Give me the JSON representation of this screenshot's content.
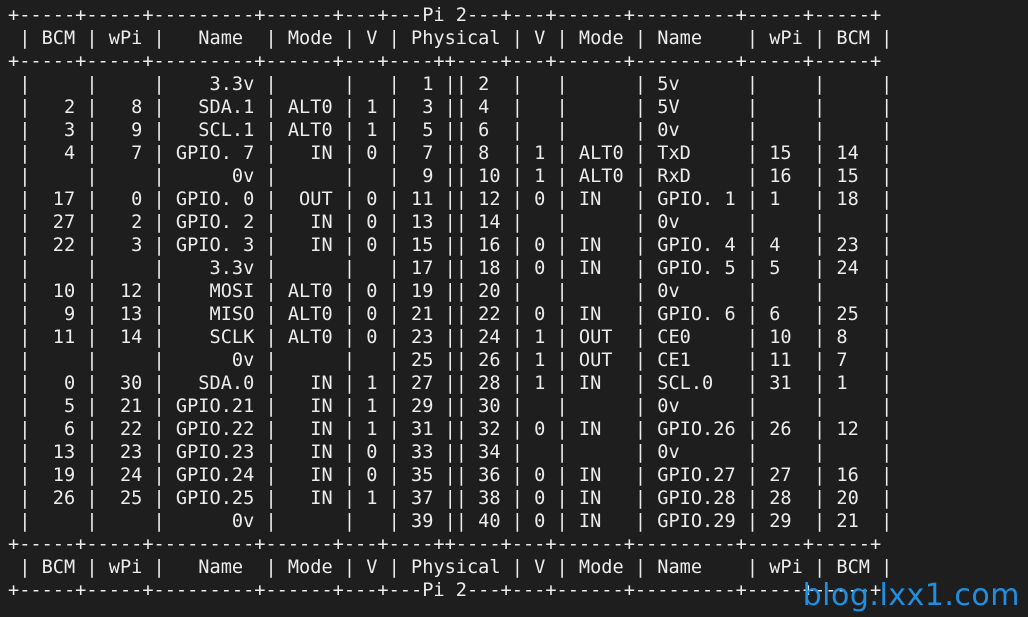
{
  "terminal": {
    "border_top": "+-----+-----+---------+------+---+---Pi 2---+---+------+---------+-----+-----+",
    "header": " | BCM | wPi |   Name  | Mode | V | Physical | V | Mode | Name    | wPi | BCM |",
    "border_mid": "+-----+-----+---------+------+---+----++----+---+------+---------+-----+-----+",
    "rows": [
      " |     |     |    3.3v |      |   |  1 || 2  |   |      | 5v      |     |     |",
      " |   2 |   8 |   SDA.1 | ALT0 | 1 |  3 || 4  |   |      | 5V      |     |     |",
      " |   3 |   9 |   SCL.1 | ALT0 | 1 |  5 || 6  |   |      | 0v      |     |     |",
      " |   4 |   7 | GPIO. 7 |   IN | 0 |  7 || 8  | 1 | ALT0 | TxD     | 15  | 14  |",
      " |     |     |      0v |      |   |  9 || 10 | 1 | ALT0 | RxD     | 16  | 15  |",
      " |  17 |   0 | GPIO. 0 |  OUT | 0 | 11 || 12 | 0 | IN   | GPIO. 1 | 1   | 18  |",
      " |  27 |   2 | GPIO. 2 |   IN | 0 | 13 || 14 |   |      | 0v      |     |     |",
      " |  22 |   3 | GPIO. 3 |   IN | 0 | 15 || 16 | 0 | IN   | GPIO. 4 | 4   | 23  |",
      " |     |     |    3.3v |      |   | 17 || 18 | 0 | IN   | GPIO. 5 | 5   | 24  |",
      " |  10 |  12 |    MOSI | ALT0 | 0 | 19 || 20 |   |      | 0v      |     |     |",
      " |   9 |  13 |    MISO | ALT0 | 0 | 21 || 22 | 0 | IN   | GPIO. 6 | 6   | 25  |",
      " |  11 |  14 |    SCLK | ALT0 | 0 | 23 || 24 | 1 | OUT  | CE0     | 10  | 8   |",
      " |     |     |      0v |      |   | 25 || 26 | 1 | OUT  | CE1     | 11  | 7   |",
      " |   0 |  30 |   SDA.0 |   IN | 1 | 27 || 28 | 1 | IN   | SCL.0   | 31  | 1   |",
      " |   5 |  21 | GPIO.21 |   IN | 1 | 29 || 30 |   |      | 0v      |     |     |",
      " |   6 |  22 | GPIO.22 |   IN | 1 | 31 || 32 | 0 | IN   | GPIO.26 | 26  | 12  |",
      " |  13 |  23 | GPIO.23 |   IN | 0 | 33 || 34 |   |      | 0v      |     |     |",
      " |  19 |  24 | GPIO.24 |   IN | 0 | 35 || 36 | 0 | IN   | GPIO.27 | 27  | 16  |",
      " |  26 |  25 | GPIO.25 |   IN | 1 | 37 || 38 | 0 | IN   | GPIO.28 | 28  | 20  |",
      " |     |     |      0v |      |   | 39 || 40 | 0 | IN   | GPIO.29 | 29  | 21  |"
    ],
    "footer_header": " | BCM | wPi |   Name  | Mode | V | Physical | V | Mode | Name    | wPi | BCM |",
    "border_bottom": "+-----+-----+---------+------+---+---Pi 2---+---+------+---------+-----+-----+"
  },
  "watermark": {
    "text": "blog.lxx1.com",
    "color": "#1f8fe0"
  },
  "theme": {
    "background": "#1e1e1e",
    "foreground": "#ececec"
  }
}
